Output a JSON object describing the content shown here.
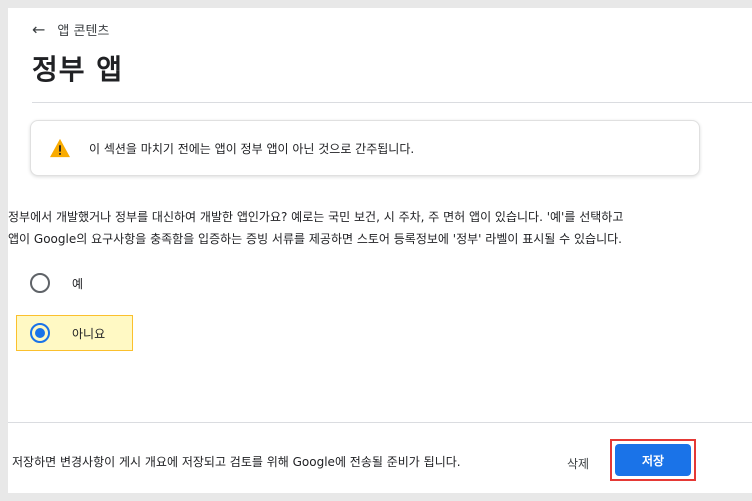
{
  "header": {
    "back_label": "앱 콘텐츠",
    "title": "정부 앱"
  },
  "warning": {
    "icon": "warning-icon",
    "accent": "#f9ab00",
    "text": "이 섹션을 마치기 전에는 앱이 정부 앱이 아닌 것으로 간주됩니다."
  },
  "question": {
    "line1": "정부에서 개발했거나 정부를 대신하여 개발한 앱인가요? 예로는 국민 보건, 시 주차, 주 면허 앱이 있습니다. '예'를 선택하고",
    "line2": "앱이 Google의 요구사항을 충족함을 입증하는 증빙 서류를 제공하면 스토어 등록정보에 '정부' 라벨이 표시될 수 있습니다."
  },
  "options": [
    {
      "label": "예",
      "selected": false
    },
    {
      "label": "아니요",
      "selected": true
    }
  ],
  "footer": {
    "note": "저장하면 변경사항이 게시 개요에 저장되고 검토를 위해 Google에 전송될 준비가 됩니다.",
    "delete_label": "삭제",
    "save_label": "저장",
    "primary_color": "#1a73e8"
  }
}
